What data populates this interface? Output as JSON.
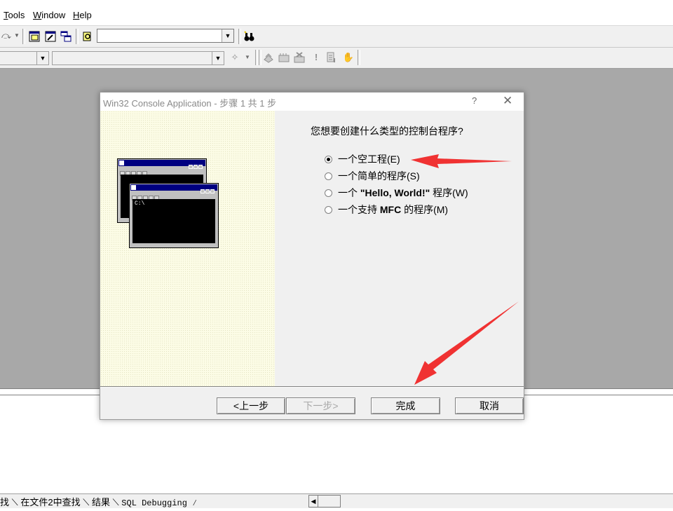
{
  "menu": {
    "items": [
      {
        "label_u": "T",
        "label_rest": "ools"
      },
      {
        "label_u": "W",
        "label_rest": "indow"
      },
      {
        "label_u": "H",
        "label_rest": "elp"
      }
    ]
  },
  "dialog": {
    "title": "Win32 Console Application - 步骤 1 共 1 步",
    "help": "?",
    "close": "✕",
    "question": "您想要创建什么类型的控制台程序?",
    "options": [
      {
        "label": "一个空工程(E)",
        "checked": true
      },
      {
        "label": "一个简单的程序(S)",
        "checked": false
      },
      {
        "pre": "一个 ",
        "bold": "\"Hello, World!\"",
        "post": " 程序(W)",
        "checked": false
      },
      {
        "pre": "一个支持 ",
        "bold": "MFC",
        "post": " 的程序(M)",
        "checked": false
      }
    ],
    "illustration_prompt": "C:\\",
    "buttons": {
      "back": "<上一步",
      "next": "下一步>",
      "finish": "完成",
      "cancel": "取消"
    }
  },
  "output_tabs": {
    "tabs": [
      "找",
      "在文件2中查找",
      "结果",
      "SQL Debugging"
    ]
  },
  "colors": {
    "accent_arrow": "#f03232",
    "workspace": "#a8a8a8",
    "dialog_left_panel": "#fcfce6"
  }
}
